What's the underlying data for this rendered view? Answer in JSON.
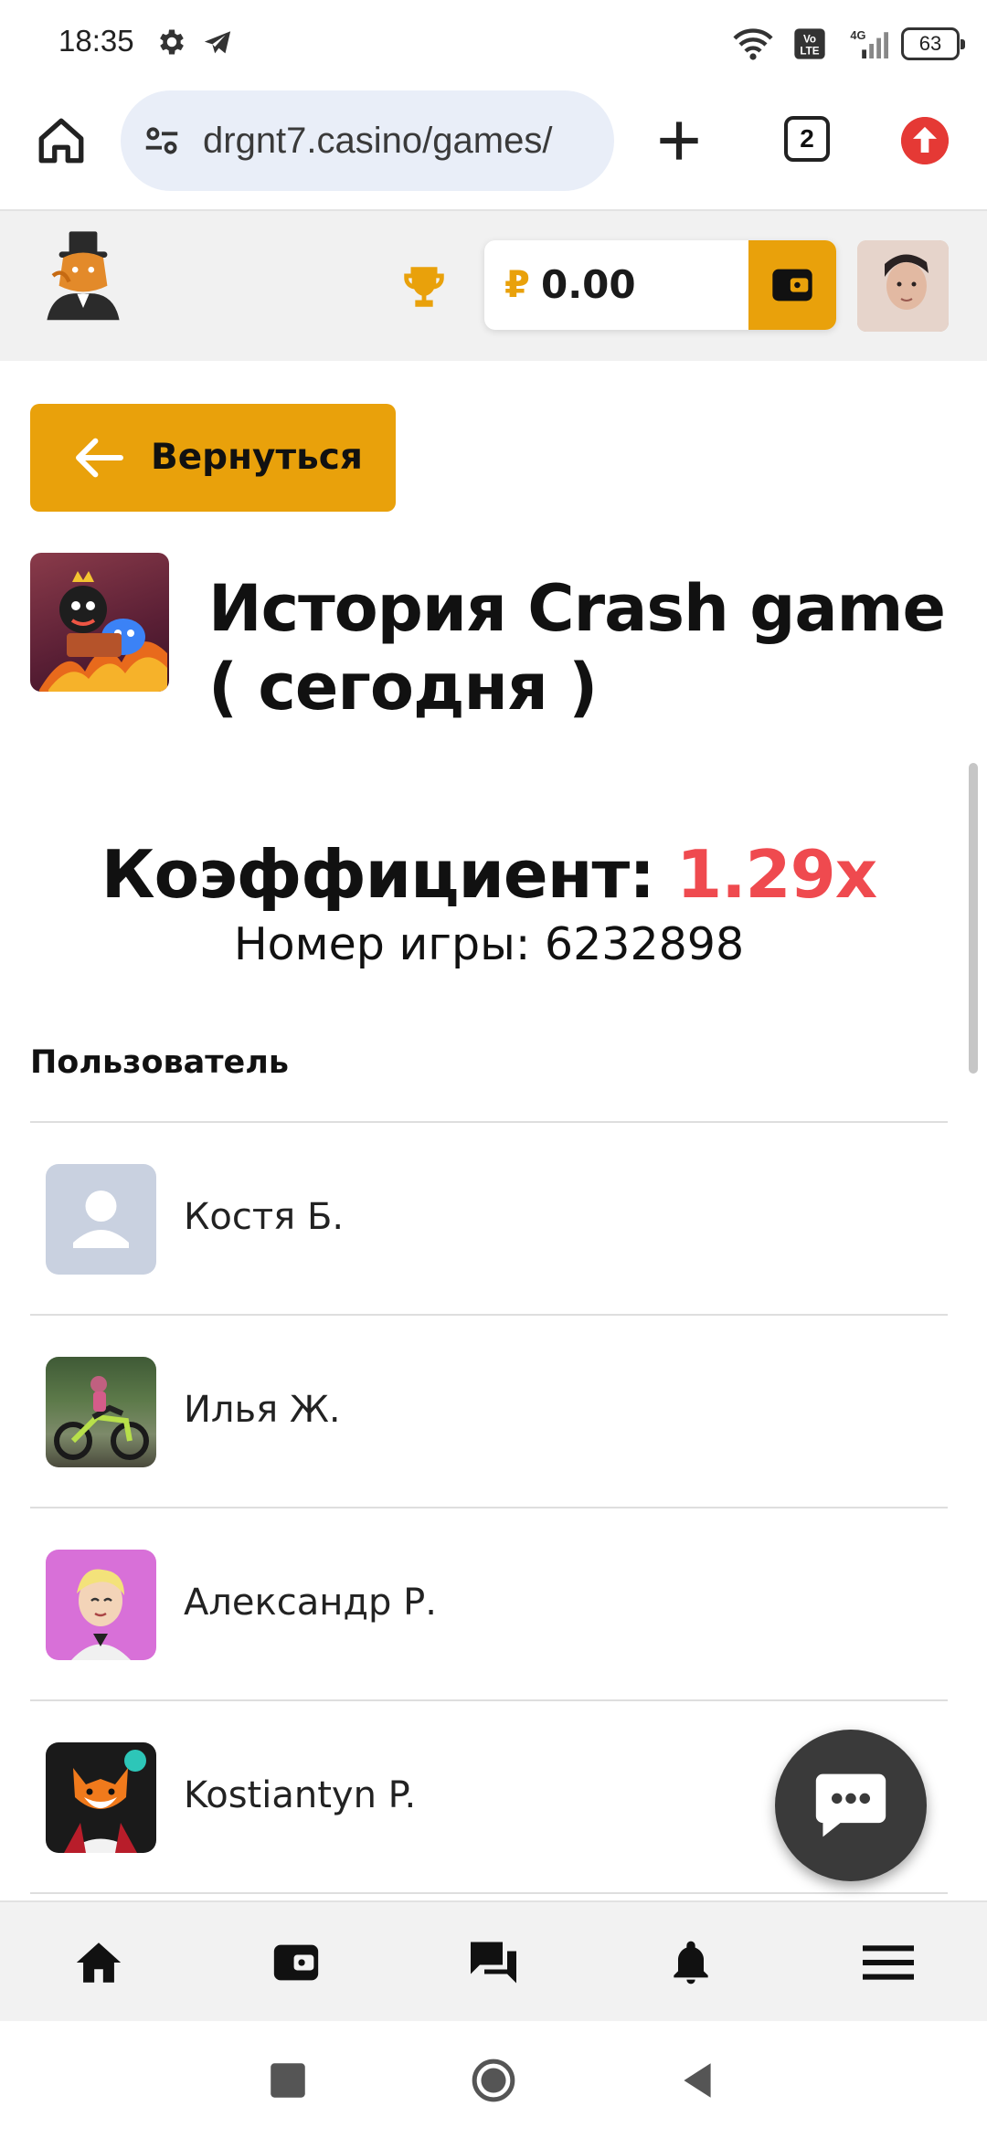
{
  "status_bar": {
    "time": "18:35",
    "battery": "63",
    "icons": [
      "gear-icon",
      "telegram-icon",
      "wifi-icon",
      "volte-icon",
      "signal-4g-icon",
      "battery-icon"
    ]
  },
  "browser": {
    "url": "drgnt7.casino/games/",
    "tabs_count": "2"
  },
  "header": {
    "currency_symbol": "₽",
    "balance": "0.00",
    "accent_color": "#e9a10b"
  },
  "main": {
    "back_label": "Вернуться",
    "title": "История Crash game ( сегодня )",
    "coefficient_label": "Коэффициент:",
    "coefficient_value": "1.29x",
    "coefficient_color": "#ef4a4f",
    "game_number_label": "Номер игры:",
    "game_number": "6232898",
    "column_header": "Пользователь",
    "users": [
      {
        "name": "Костя Б.",
        "avatar": "default-avatar"
      },
      {
        "name": "Илья Ж.",
        "avatar": "motorcycle-photo"
      },
      {
        "name": "Александр Р.",
        "avatar": "cartoon-avatar"
      },
      {
        "name": "Kostiantyn P.",
        "avatar": "fox-avatar"
      }
    ]
  },
  "bottom_nav": {
    "items": [
      "home-icon",
      "wallet-icon",
      "chat-icon",
      "bell-icon",
      "menu-icon"
    ]
  }
}
